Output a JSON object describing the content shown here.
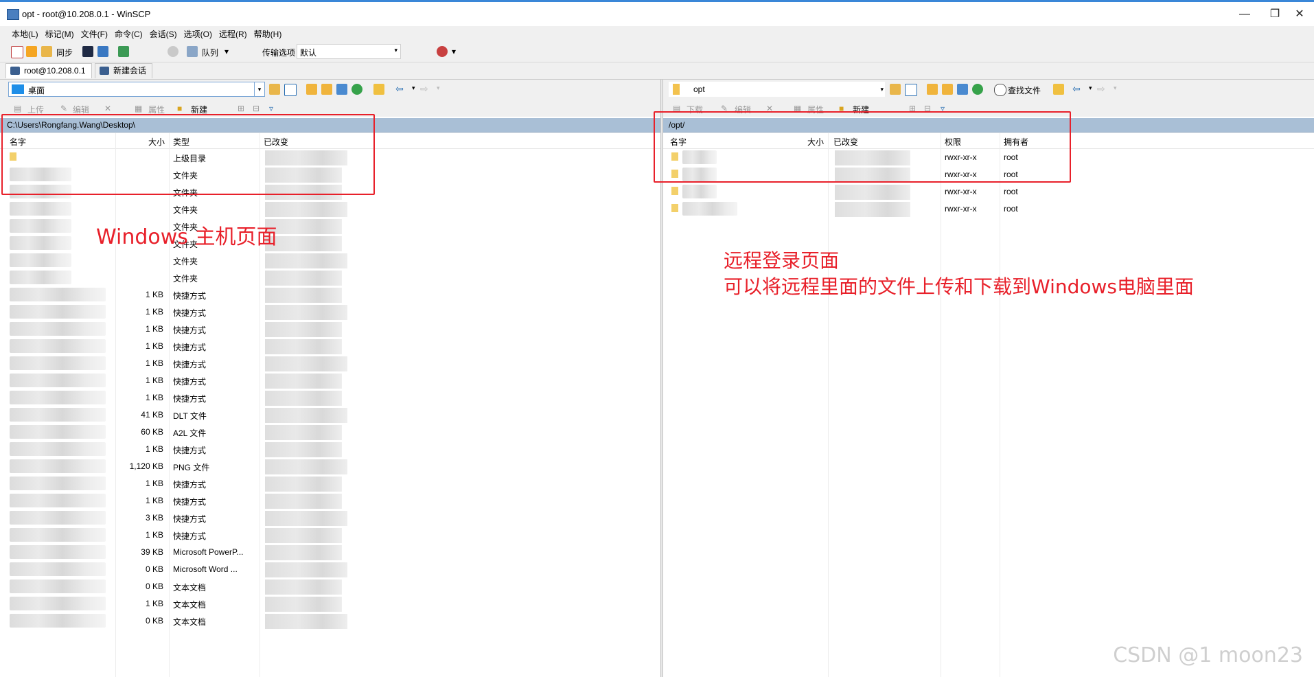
{
  "window": {
    "title": "opt - root@10.208.0.1 - WinSCP",
    "min": "—",
    "max": "❐",
    "close": "✕"
  },
  "menu": [
    "本地(L)",
    "标记(M)",
    "文件(F)",
    "命令(C)",
    "会话(S)",
    "选项(O)",
    "远程(R)",
    "帮助(H)"
  ],
  "toolbar": {
    "sync_label": "同步",
    "queue_label": "队列",
    "transfer_label": "传输选项",
    "transfer_value": "默认"
  },
  "tabs": {
    "session": "root@10.208.0.1",
    "new_session": "新建会话"
  },
  "left": {
    "location": "桌面",
    "actions": {
      "upload": "上传",
      "edit": "编辑",
      "props": "属性",
      "new": "新建"
    },
    "path": "C:\\Users\\Rongfang.Wang\\Desktop\\",
    "columns": {
      "name": "名字",
      "size": "大小",
      "type": "类型",
      "modified": "已改变"
    },
    "rows": [
      {
        "size": "",
        "type": "上级目录"
      },
      {
        "size": "",
        "type": "文件夹"
      },
      {
        "size": "",
        "type": "文件夹"
      },
      {
        "size": "",
        "type": "文件夹"
      },
      {
        "size": "",
        "type": "文件夹"
      },
      {
        "size": "",
        "type": "文件夹"
      },
      {
        "size": "",
        "type": "文件夹"
      },
      {
        "size": "",
        "type": "文件夹"
      },
      {
        "size": "1 KB",
        "type": "快捷方式"
      },
      {
        "size": "1 KB",
        "type": "快捷方式"
      },
      {
        "size": "1 KB",
        "type": "快捷方式"
      },
      {
        "size": "1 KB",
        "type": "快捷方式"
      },
      {
        "size": "1 KB",
        "type": "快捷方式"
      },
      {
        "size": "1 KB",
        "type": "快捷方式"
      },
      {
        "size": "1 KB",
        "type": "快捷方式"
      },
      {
        "size": "41 KB",
        "type": "DLT 文件"
      },
      {
        "size": "60 KB",
        "type": "A2L 文件"
      },
      {
        "size": "1 KB",
        "type": "快捷方式"
      },
      {
        "size": "1,120 KB",
        "type": "PNG 文件"
      },
      {
        "size": "1 KB",
        "type": "快捷方式"
      },
      {
        "size": "1 KB",
        "type": "快捷方式"
      },
      {
        "size": "3 KB",
        "type": "快捷方式"
      },
      {
        "size": "1 KB",
        "type": "快捷方式"
      },
      {
        "size": "39 KB",
        "type": "Microsoft PowerP..."
      },
      {
        "size": "0 KB",
        "type": "Microsoft Word ..."
      },
      {
        "size": "0 KB",
        "type": "文本文档"
      },
      {
        "size": "1 KB",
        "type": "文本文档"
      },
      {
        "size": "0 KB",
        "type": "文本文档"
      }
    ]
  },
  "right": {
    "location": "opt",
    "find_label": "查找文件",
    "actions": {
      "download": "下载",
      "edit": "编辑",
      "props": "属性",
      "new": "新建"
    },
    "path": "/opt/",
    "columns": {
      "name": "名字",
      "size": "大小",
      "modified": "已改变",
      "perms": "权限",
      "owner": "拥有者"
    },
    "rows": [
      {
        "perms": "rwxr-xr-x",
        "owner": "root"
      },
      {
        "perms": "rwxr-xr-x",
        "owner": "root"
      },
      {
        "perms": "rwxr-xr-x",
        "owner": "root"
      },
      {
        "perms": "rwxr-xr-x",
        "owner": "root"
      }
    ]
  },
  "annotations": {
    "left": "Windows 主机页面",
    "right_line1": "远程登录页面",
    "right_line2": "可以将远程里面的文件上传和下载到Windows电脑里面"
  },
  "watermark": "CSDN @1 moon23",
  "colors": {
    "annotation_red": "#e8202a",
    "path_bar": "#a9bfd6",
    "title_accent": "#3a87d8"
  }
}
